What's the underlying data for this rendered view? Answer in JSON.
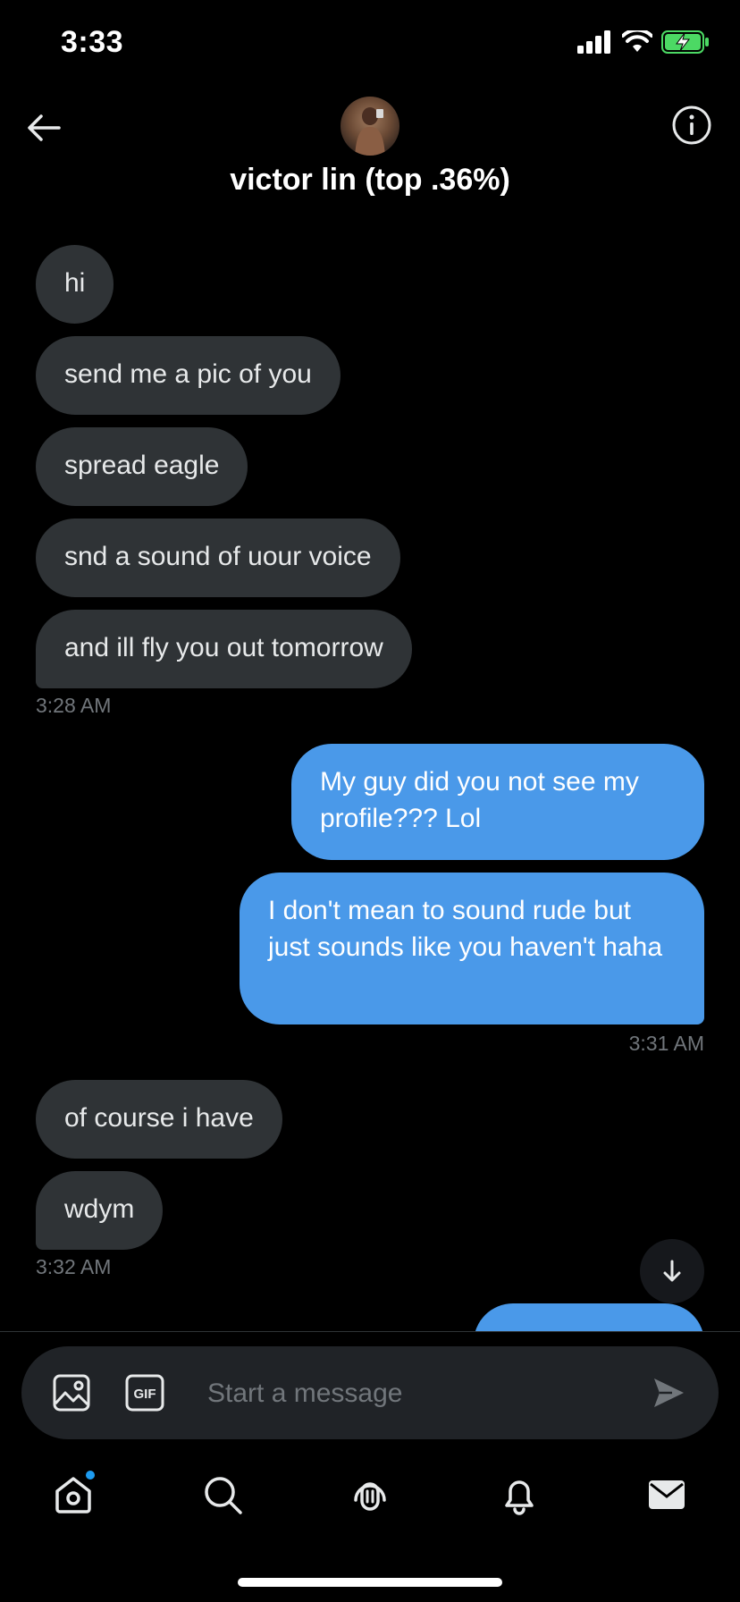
{
  "status": {
    "time": "3:33"
  },
  "header": {
    "title": "victor lin (top .36%)"
  },
  "messages": [
    {
      "text": "hi"
    },
    {
      "text": "send me a pic of you"
    },
    {
      "text": "spread eagle"
    },
    {
      "text": "snd a sound of uour voice"
    },
    {
      "text": "and ill fly you out tomorrow"
    },
    {
      "ts": "3:28 AM"
    },
    {
      "text": "My guy did you not see my profile??? Lol"
    },
    {
      "text": "I don't mean to sound rude but just sounds like you haven't haha"
    },
    {
      "ts": "3:31 AM"
    },
    {
      "text": "of course i have"
    },
    {
      "text": "wdym"
    },
    {
      "ts": "3:32 AM"
    }
  ],
  "composer": {
    "placeholder": "Start a message",
    "gif_label": "GIF"
  },
  "colors": {
    "accent": "#1d9bf0",
    "outgoing_bubble": "#4a99e9",
    "incoming_bubble": "#2f3336",
    "battery": "#4cd964"
  }
}
